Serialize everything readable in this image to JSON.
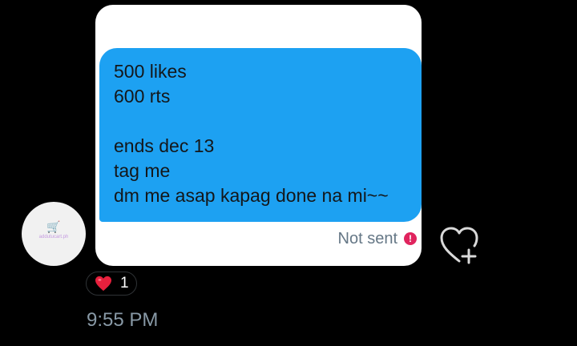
{
  "message": {
    "lines": [
      "500 likes",
      "600 rts",
      "",
      "ends dec 13",
      "tag me",
      "dm me asap kapag done na mi~~"
    ],
    "bubble_color": "#1da1f2"
  },
  "status": {
    "text": "Not sent",
    "icon": "error-icon",
    "icon_glyph": "!"
  },
  "avatar": {
    "cart_glyph": "🛒",
    "text": "addutucart.ph"
  },
  "like_button": {
    "icon": "heart-plus-icon"
  },
  "reaction": {
    "emoji": "heart-emoji",
    "count": "1"
  },
  "timestamp": "9:55 PM"
}
